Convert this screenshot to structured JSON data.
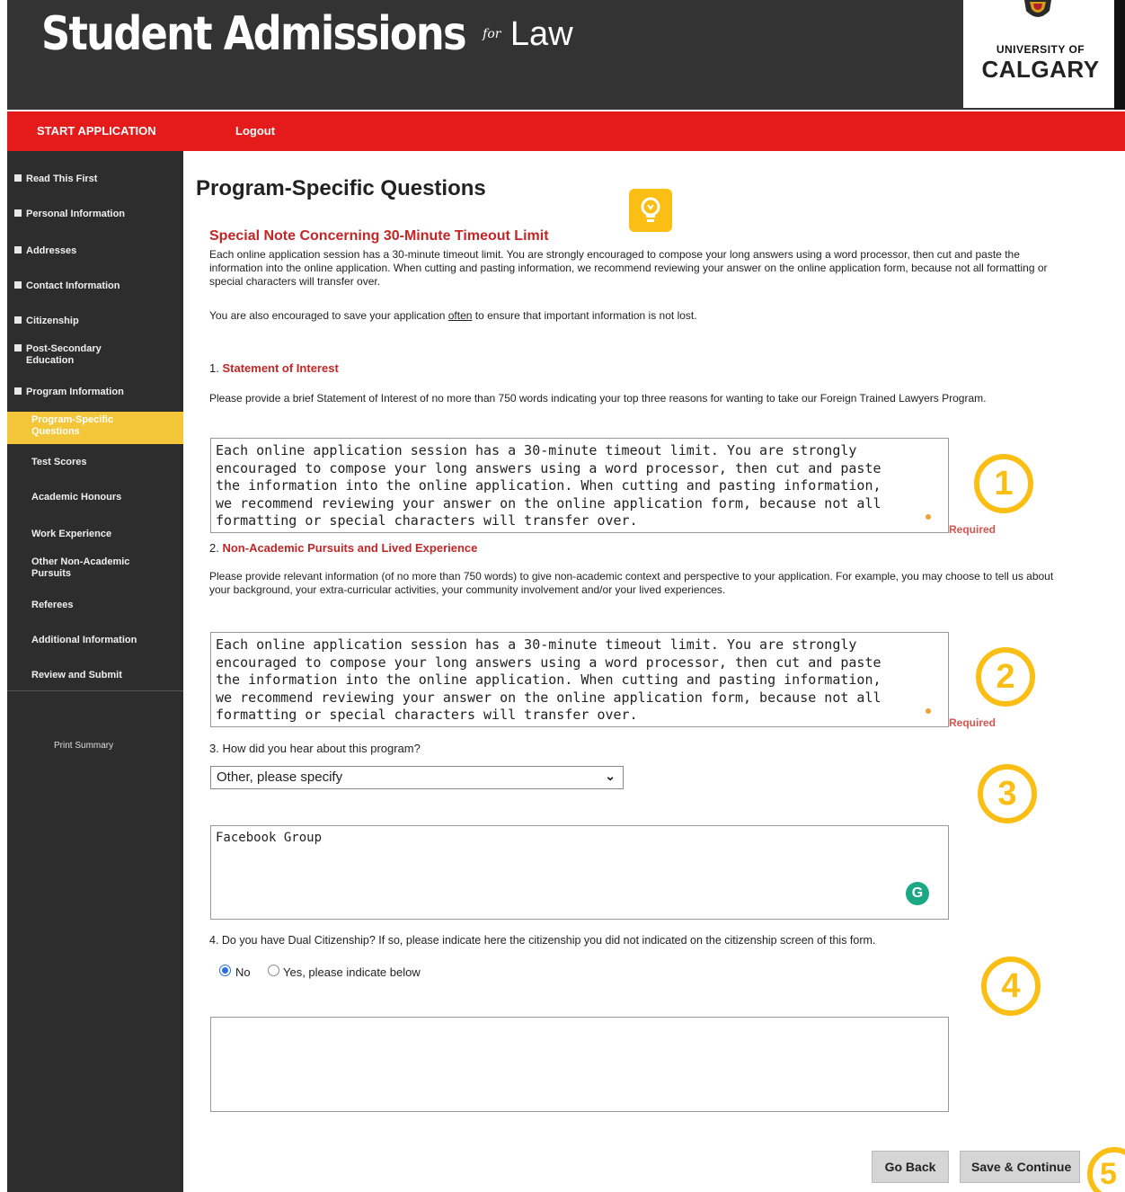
{
  "header": {
    "title_main": "Student Admissions",
    "title_for": "for",
    "title_law": "Law",
    "logo_small": "UNIVERSITY OF",
    "logo_big": "CALGARY"
  },
  "topnav": {
    "start": "START APPLICATION",
    "logout": "Logout"
  },
  "sidebar": {
    "items": [
      "Read This First",
      "Personal Information",
      "Addresses",
      "Contact Information",
      "Citizenship",
      "Post-Secondary Education",
      "Program Information"
    ],
    "active": "Program-Specific Questions",
    "subitems": [
      "Test Scores",
      "Academic Honours",
      "Work Experience",
      "Other Non-Academic Pursuits",
      "Referees",
      "Additional Information",
      "Review and Submit"
    ],
    "print_summary": "Print Summary"
  },
  "page": {
    "title": "Program-Specific Questions",
    "note_title": "Special Note Concerning 30-Minute Timeout Limit",
    "note_body": "Each online application session has a 30-minute timeout limit. You are strongly encouraged to compose your long answers using a word processor, then cut and paste the information into the online application. When cutting and pasting information, we recommend reviewing your answer on the online application form, because not all formatting or special characters will transfer over.",
    "save_pre": "You are also encouraged to save your application ",
    "save_often": "often",
    "save_post": " to ensure that important information is not lost."
  },
  "q1": {
    "number": "1.",
    "title": "Statement of Interest",
    "prompt": "Please provide a brief Statement of Interest of no more than 750 words indicating your top three reasons for wanting to take our Foreign Trained Lawyers Program.",
    "answer": "Each online application session has a 30-minute timeout limit. You are strongly\nencouraged to compose your long answers using a word processor, then cut and paste\nthe information into the online application. When cutting and pasting information,\nwe recommend reviewing your answer on the online application form, because not all\nformatting or special characters will transfer over.",
    "required": "Required"
  },
  "q2": {
    "number": "2.",
    "title": "Non-Academic Pursuits and Lived Experience",
    "prompt": "Please provide relevant information (of no more than 750 words) to give non-academic context and perspective to your application. For example, you may choose to tell us about your background, your extra-curricular activities, your community involvement and/or your lived experiences.",
    "answer": "Each online application session has a 30-minute timeout limit. You are strongly\nencouraged to compose your long answers using a word processor, then cut and paste\nthe information into the online application. When cutting and pasting information,\nwe recommend reviewing your answer on the online application form, because not all\nformatting or special characters will transfer over.",
    "required": "Required"
  },
  "q3": {
    "prompt": "3. How did you hear about this program?",
    "selected": "Other, please specify",
    "specify": "Facebook Group"
  },
  "q4": {
    "prompt": "4. Do you have Dual Citizenship? If so, please indicate here the citizenship you did not indicated on the citizenship screen of this form.",
    "option_no": "No",
    "option_yes": "Yes, please indicate below",
    "selected": "No",
    "answer": ""
  },
  "markers": [
    "1",
    "2",
    "3",
    "4",
    "5"
  ],
  "buttons": {
    "back": "Go Back",
    "save": "Save & Continue"
  },
  "icons": {
    "bulb": "lightbulb-icon",
    "grammarly": "grammarly-icon",
    "chevron": "chevron-down-icon"
  },
  "colors": {
    "header_bg": "#333333",
    "nav_red": "#e51a1a",
    "sidebar_bg": "#2d2d2d",
    "active_yellow": "#f4c63a",
    "accent_red": "#c22626",
    "marker_yellow": "#fbbe14"
  }
}
